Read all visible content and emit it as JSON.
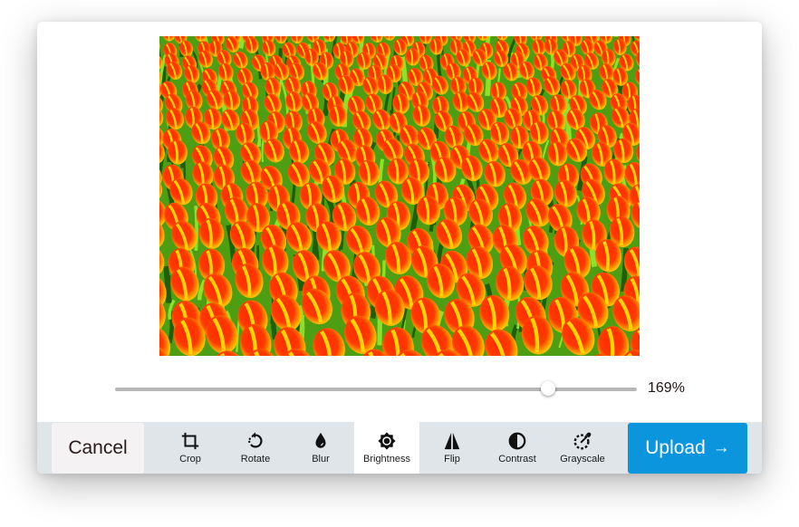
{
  "editor": {
    "preview": {
      "alt": "Field of red and yellow tulips",
      "description": "Photo of many red-and-yellow tulips with green leaves, brightened"
    },
    "zoom": {
      "value_label": "169%",
      "value_percent": 169,
      "slider_fraction": 0.83
    },
    "toolbar": {
      "cancel_label": "Cancel",
      "upload_label": "Upload",
      "upload_icon": "arrow-right-icon",
      "active_tool": "Brightness",
      "tools": [
        {
          "label": "Crop",
          "icon": "crop-icon"
        },
        {
          "label": "Rotate",
          "icon": "rotate-icon"
        },
        {
          "label": "Blur",
          "icon": "drop-icon"
        },
        {
          "label": "Brightness",
          "icon": "brightness-icon"
        },
        {
          "label": "Flip",
          "icon": "flip-icon"
        },
        {
          "label": "Contrast",
          "icon": "contrast-icon"
        },
        {
          "label": "Grayscale",
          "icon": "eyedropper-icon"
        }
      ]
    },
    "colors": {
      "accent": "#0a95dd",
      "toolbar_bg": "#dfe5e9",
      "active_tool_bg": "#ffffff",
      "cancel_bg": "#f4f2f2"
    }
  }
}
